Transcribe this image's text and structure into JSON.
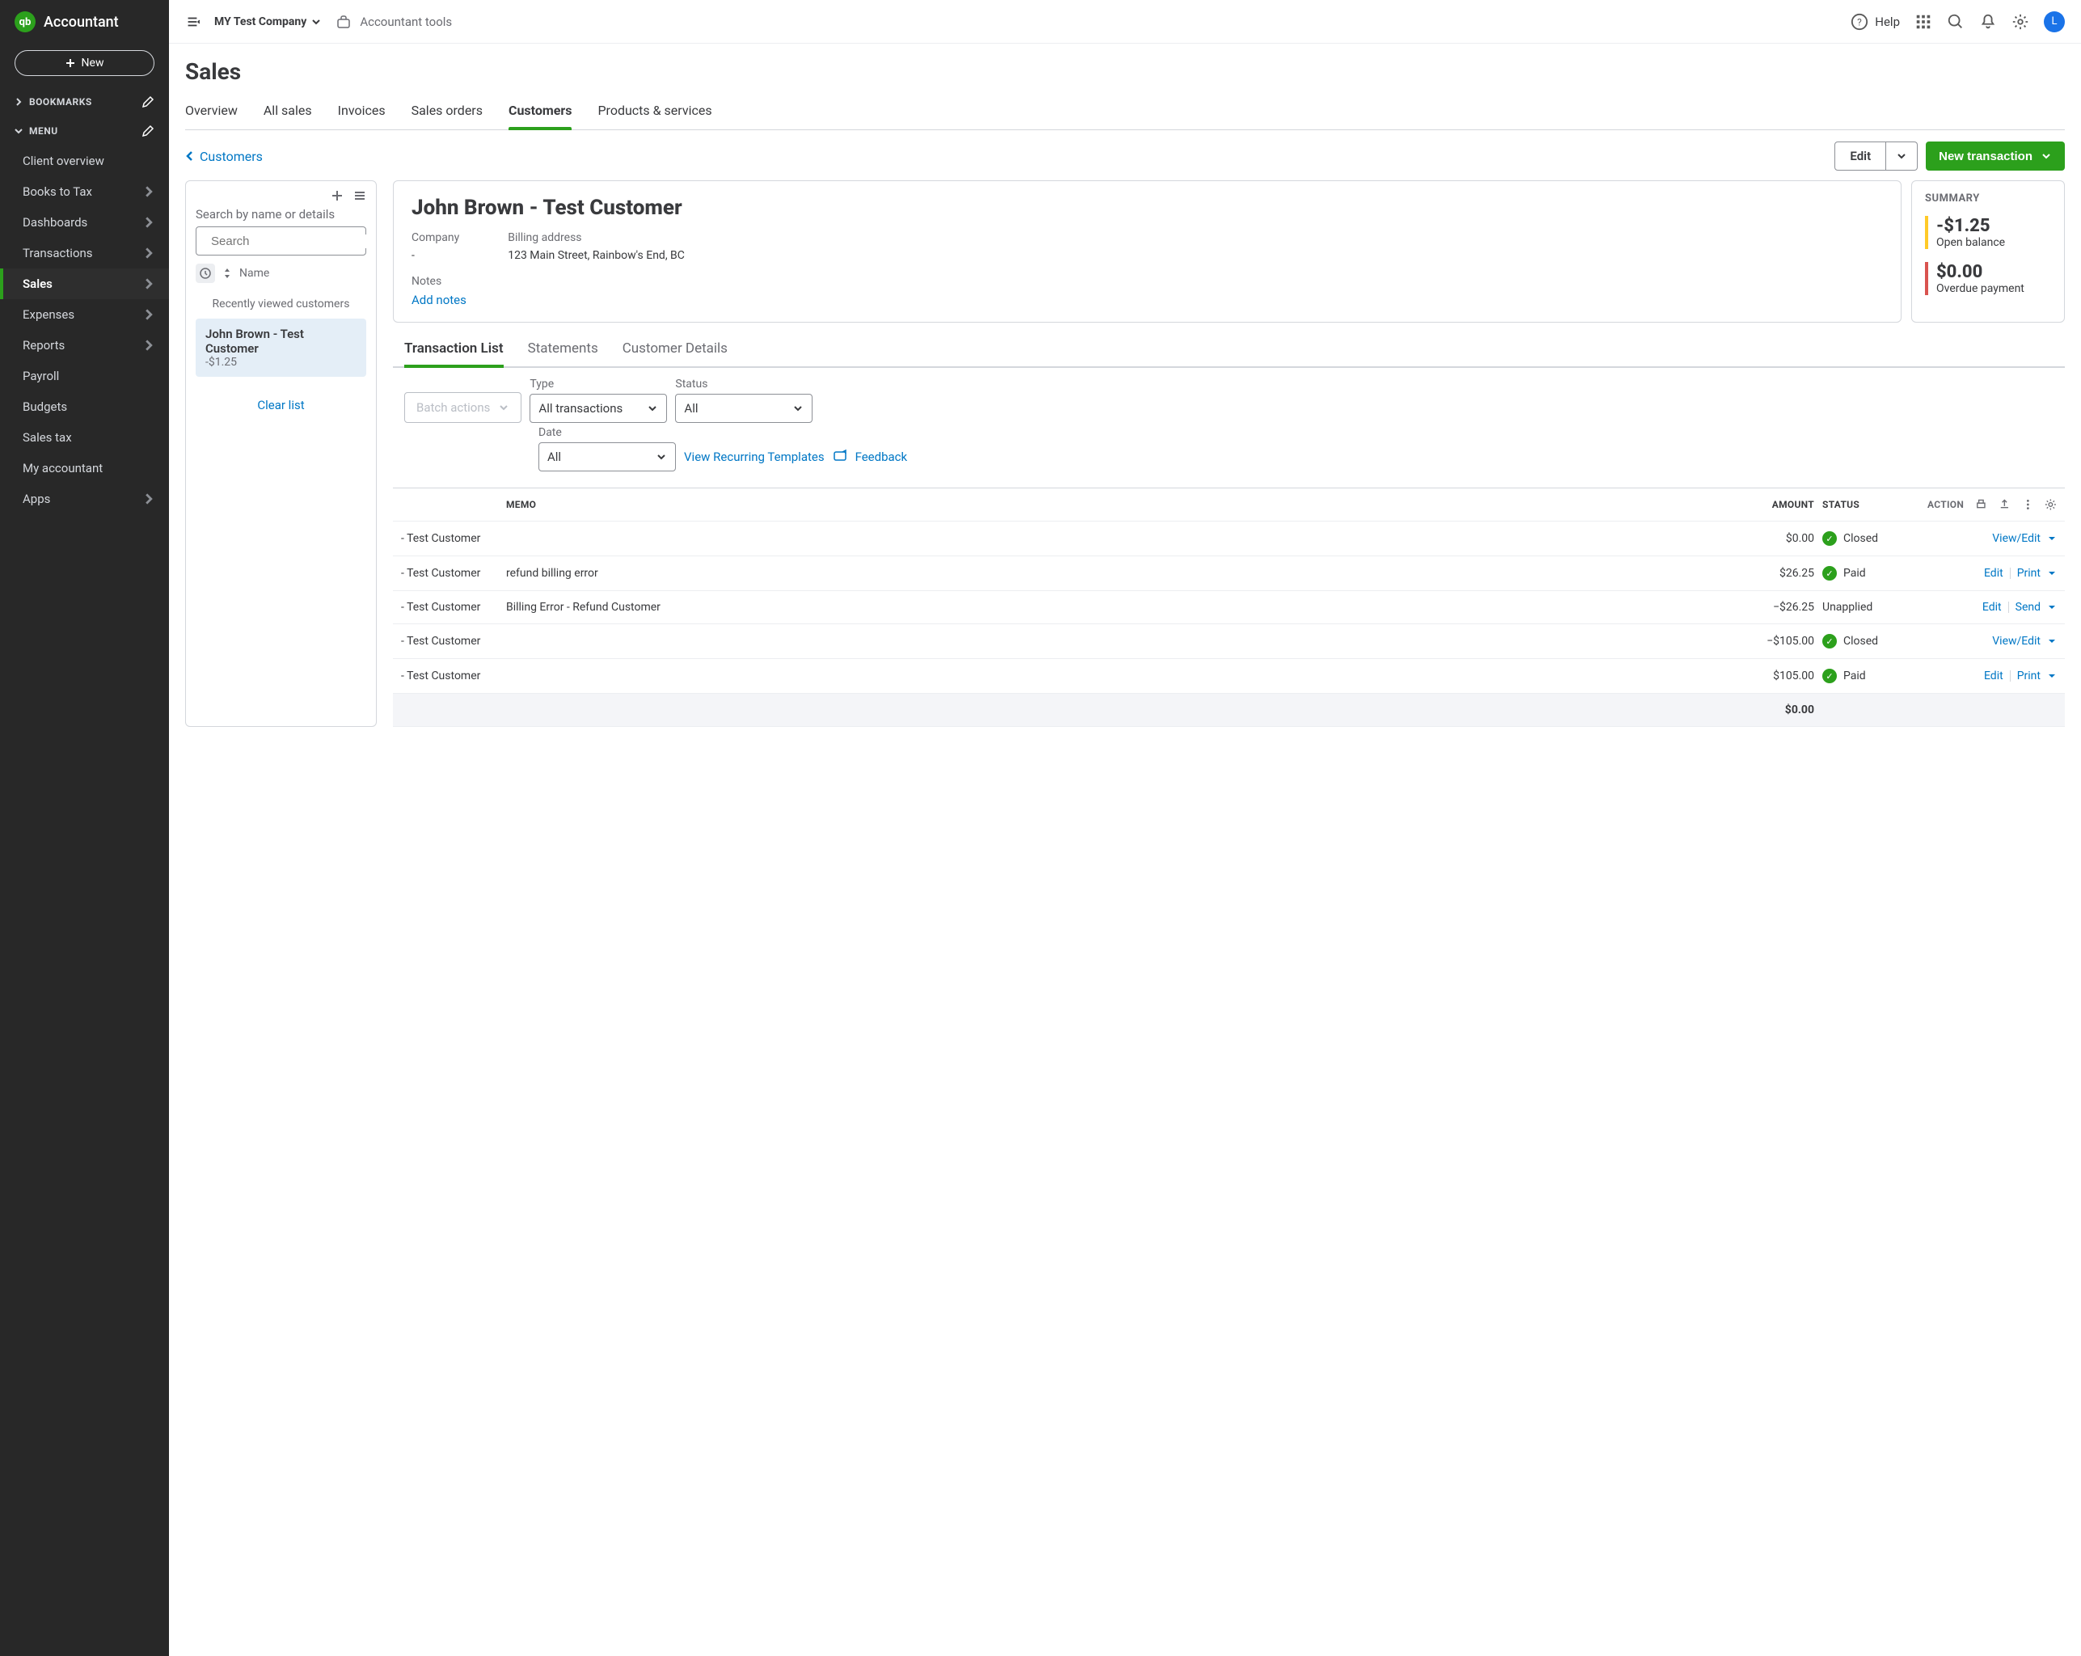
{
  "app_name": "Accountant",
  "logo_text": "qb",
  "new_button": "New",
  "sections": {
    "bookmarks": "BOOKMARKS",
    "menu": "MENU"
  },
  "nav": [
    {
      "label": "Client overview",
      "chev": false
    },
    {
      "label": "Books to Tax",
      "chev": true
    },
    {
      "label": "Dashboards",
      "chev": true
    },
    {
      "label": "Transactions",
      "chev": true
    },
    {
      "label": "Sales",
      "chev": true,
      "active": true
    },
    {
      "label": "Expenses",
      "chev": true
    },
    {
      "label": "Reports",
      "chev": true
    },
    {
      "label": "Payroll",
      "chev": false
    },
    {
      "label": "Budgets",
      "chev": false
    },
    {
      "label": "Sales tax",
      "chev": false
    },
    {
      "label": "My accountant",
      "chev": false
    },
    {
      "label": "Apps",
      "chev": true
    }
  ],
  "topbar": {
    "company": "MY Test Company",
    "tools": "Accountant tools",
    "help": "Help",
    "avatar": "L"
  },
  "page_title": "Sales",
  "tabs": [
    "Overview",
    "All sales",
    "Invoices",
    "Sales orders",
    "Customers",
    "Products & services"
  ],
  "active_tab": 4,
  "back_label": "Customers",
  "edit_label": "Edit",
  "new_trx": "New transaction",
  "left_panel": {
    "label": "Search by name or details",
    "placeholder": "Search",
    "sort": "Name",
    "recent": "Recently viewed customers",
    "customer": {
      "name": "John Brown - Test Customer",
      "bal": "-$1.25"
    },
    "clear": "Clear list"
  },
  "customer": {
    "name": "John Brown - Test Customer",
    "company_lbl": "Company",
    "company_val": "-",
    "addr_lbl": "Billing address",
    "addr_val": "123 Main Street, Rainbow's End, BC",
    "notes_lbl": "Notes",
    "notes_link": "Add notes"
  },
  "summary": {
    "title": "SUMMARY",
    "open_val": "-$1.25",
    "open_lbl": "Open balance",
    "over_val": "$0.00",
    "over_lbl": "Overdue payment"
  },
  "inner_tabs": [
    "Transaction List",
    "Statements",
    "Customer Details"
  ],
  "filters": {
    "batch": "Batch actions",
    "type_lbl": "Type",
    "type_val": "All transactions",
    "status_lbl": "Status",
    "status_val": "All",
    "date_lbl": "Date",
    "date_val": "All",
    "recurring": "View Recurring Templates",
    "feedback": "Feedback"
  },
  "table": {
    "headers": {
      "memo": "MEMO",
      "amount": "AMOUNT",
      "status": "STATUS",
      "action": "ACTION"
    },
    "rows": [
      {
        "name": "- Test Customer",
        "memo": "",
        "amount": "$0.00",
        "status": "Closed",
        "dot": true,
        "actions": [
          "View/Edit"
        ]
      },
      {
        "name": "- Test Customer",
        "memo": "refund billing error",
        "amount": "$26.25",
        "status": "Paid",
        "dot": true,
        "actions": [
          "Edit",
          "Print"
        ]
      },
      {
        "name": "- Test Customer",
        "memo": "Billing Error - Refund Customer",
        "amount": "−$26.25",
        "status": "Unapplied",
        "dot": false,
        "actions": [
          "Edit",
          "Send"
        ]
      },
      {
        "name": "- Test Customer",
        "memo": "",
        "amount": "−$105.00",
        "status": "Closed",
        "dot": true,
        "actions": [
          "View/Edit"
        ]
      },
      {
        "name": "- Test Customer",
        "memo": "",
        "amount": "$105.00",
        "status": "Paid",
        "dot": true,
        "actions": [
          "Edit",
          "Print"
        ]
      }
    ],
    "total": "$0.00"
  }
}
